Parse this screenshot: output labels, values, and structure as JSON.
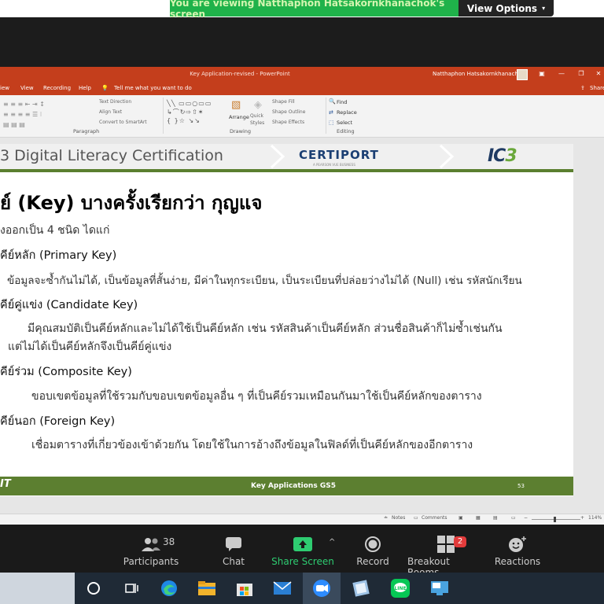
{
  "banner": {
    "viewing_text": "You are viewing Natthaphon Hatsakornkhanachok's screen",
    "view_options": "View Options"
  },
  "powerpoint": {
    "title": "Key Application-revised  -  PowerPoint",
    "user": "Natthaphon Hatsakornkhanachok",
    "tabs": [
      "iew",
      "View",
      "Recording",
      "Help",
      "Tell me what you want to do"
    ],
    "share": "Share",
    "ribbon": {
      "paragraph_label": "Paragraph",
      "drawing_label": "Drawing",
      "editing_label": "Editing",
      "text_direction": "Text Direction",
      "align_text": "Align Text",
      "convert_smartart": "Convert to SmartArt",
      "arrange": "Arrange",
      "quick_styles": "Quick Styles",
      "shape_fill": "Shape Fill",
      "shape_outline": "Shape Outline",
      "shape_effects": "Shape Effects",
      "find": "Find",
      "replace": "Replace",
      "select": "Select"
    },
    "status": {
      "notes": "Notes",
      "comments": "Comments",
      "zoom": "114%"
    }
  },
  "slide": {
    "header_title": "3 Digital Literacy Certification",
    "certiport": "CERTIPORT",
    "certiport_sub": "A PEARSON VUE BUSINESS",
    "ic3_prefix": "IC",
    "ic3_suffix": "3",
    "heading": "ย์ (Key) บางครั้งเรียกว่า กุญแจ",
    "intro": "งออกเป็น 4 ชนิด ไดแก่",
    "sections": [
      {
        "title": "คีย์หลัก (Primary Key)",
        "lines": [
          "ข้อมูลจะซ้ำกันไม่ได้, เป็นข้อมูลที่สั้นง่าย, มีค่าในทุกระเบียน, เป็นระเบียนที่ปล่อยว่างไม่ได้ (Null) เช่น รหัสนักเรียน"
        ]
      },
      {
        "title": "คีย์คู่แข่ง (Candidate Key)",
        "lines": [
          "มีคุณสมบัติเป็นคีย์หลักและไม่ได้ใช้เป็นคีย์หลัก เช่น รหัสสินค้าเป็นคีย์หลัก ส่วนชื่อสินค้าก็ไม่ซ้ำเช่นกัน",
          "แต่ไม่ได้เป็นคีย์หลักจึงเป็นคีย์คู่แข่ง"
        ]
      },
      {
        "title": "คีย์ร่วม (Composite Key)",
        "lines": [
          "ขอบเขตข้อมูลที่ใช้รวมกับขอบเขตข้อมูลอื่น ๆ ที่เป็นคีย์รวมเหมือนกันมาใช้เป็นคีย์หลักของตาราง"
        ]
      },
      {
        "title": "คีย์นอก (Foreign Key)",
        "lines": [
          "เชื่อมตารางที่เกี่ยวข้องเข้าด้วยกัน โดยใช้ในการอ้างถึงข้อมูลในฟิลด์ที่เป็นคีย์หลักของอีกตาราง"
        ]
      }
    ],
    "footer_logo": "IT",
    "footer_title": "Key Applications GS5",
    "page_number": "53"
  },
  "zoom_toolbar": {
    "participants_label": "Participants",
    "participants_count": "38",
    "chat_label": "Chat",
    "share_label": "Share Screen",
    "record_label": "Record",
    "breakout_label": "Breakout Rooms",
    "breakout_count": "2",
    "reactions_label": "Reactions"
  }
}
